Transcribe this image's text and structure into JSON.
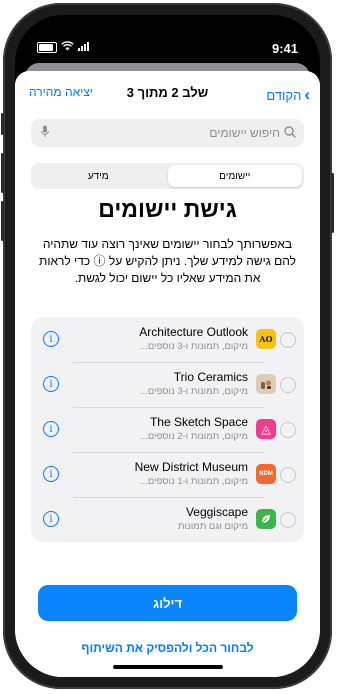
{
  "status_bar": {
    "time": "9:41"
  },
  "nav": {
    "back_label": "הקודם",
    "title": "שלב 2 מתוך 3",
    "quick_exit_label": "יציאה מהירה"
  },
  "search": {
    "placeholder": "חיפוש יישומים"
  },
  "segments": [
    {
      "label": "יישומים",
      "selected": true
    },
    {
      "label": "מידע",
      "selected": false
    }
  ],
  "page_title": "גישת יישומים",
  "description": "באפשרותך לבחור יישומים שאינך רוצה עוד שתהיה להם גישה למידע שלך. ניתן להקיש על ⓘ כדי לראות את המידע שאליו כל יישום יכול לגשת.",
  "apps": [
    {
      "name": "Architecture Outlook",
      "detail": "מיקום, תמונות ו-3 נוספים...",
      "icon": "ao-icon",
      "icon_text": "AO",
      "icon_bg": "#f6c21a",
      "icon_fg": "#1e1e1e"
    },
    {
      "name": "Trio Ceramics",
      "detail": "מיקום, תמונות ו-3 נוספים...",
      "icon": "ceramics-icon",
      "icon_text": "",
      "icon_bg": "#d8cdb8",
      "icon_fg": "#8a5a3c"
    },
    {
      "name": "The Sketch Space",
      "detail": "מיקום, תמונות ו-2 נוספים...",
      "icon": "sketch-icon",
      "icon_text": "◬",
      "icon_bg": "#ef3f8a",
      "icon_fg": "#ffffff"
    },
    {
      "name": "New District Museum",
      "detail": "מיקום, תמונות ו-1 נוספים...",
      "icon": "museum-icon",
      "icon_text": "NDM",
      "icon_bg": "#f26a2a",
      "icon_fg": "#ffffff"
    },
    {
      "name": "Veggiscape",
      "detail": "מיקום וגם תמונות",
      "icon": "veggiscape-icon",
      "icon_text": "",
      "icon_bg": "#3cb54a",
      "icon_fg": "#ffffff"
    }
  ],
  "skip_button": "דילוג",
  "stop_all_link": "לבחור הכל ולהפסיק את השיתוף"
}
